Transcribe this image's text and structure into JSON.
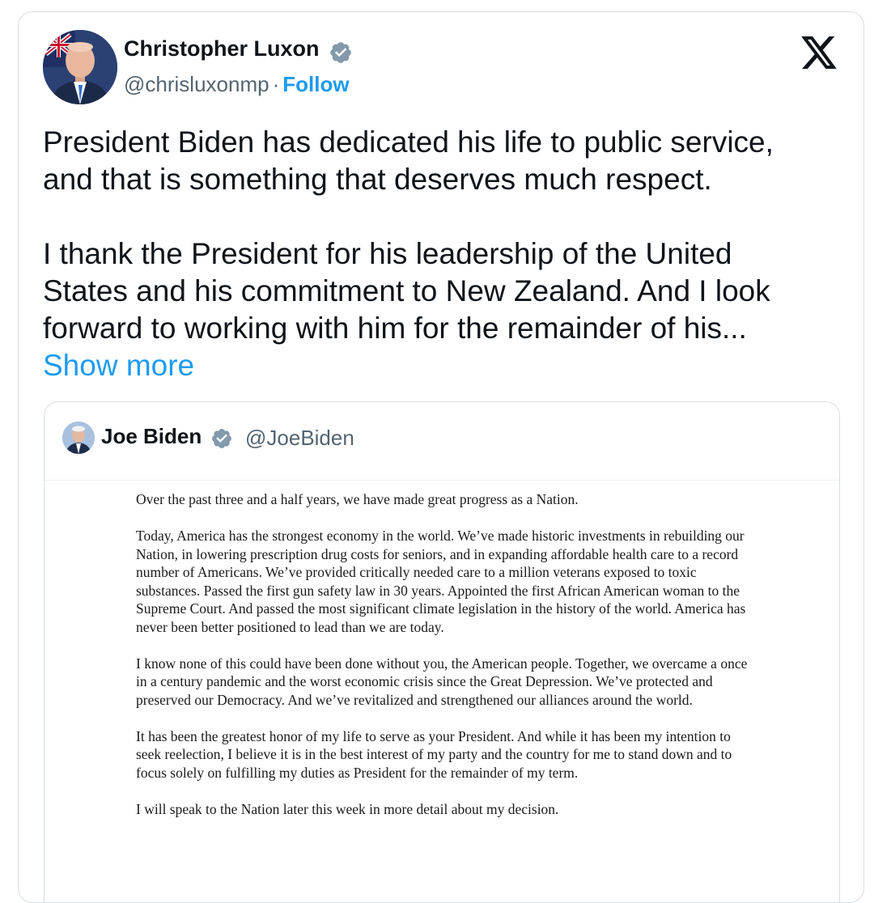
{
  "author": {
    "name": "Christopher Luxon",
    "handle": "@chrisluxonmp",
    "separator": "·",
    "follow_label": "Follow"
  },
  "icons": {
    "verified": "verified-badge-icon",
    "platform_logo": "x-logo-icon"
  },
  "tweet": {
    "paragraph_1": "President Biden has dedicated his life to public service, and that is something that deserves much respect.",
    "paragraph_2": "I thank the President for his leadership of the United States and his commitment to New Zealand. And I look forward to working with him for the remainder of his...",
    "show_more_label": "Show more"
  },
  "quoted_tweet": {
    "name": "Joe Biden",
    "handle": "@JoeBiden",
    "letter_paragraphs": [
      "Over the past three and a half years, we have made great progress as a Nation.",
      "Today, America has the strongest economy in the world. We’ve made historic investments in rebuilding our Nation, in lowering prescription drug costs for seniors, and in expanding affordable health care to a record number of Americans. We’ve provided critically needed care to a million veterans exposed to toxic substances. Passed the first gun safety law in 30 years. Appointed the first African American woman to the Supreme Court. And passed the most significant climate legislation in the history of the world. America has never been better positioned to lead than we are today.",
      "I know none of this could have been done without you, the American people. Together, we overcame a once in a century pandemic and the worst economic crisis since the Great Depression. We’ve protected and preserved our Democracy. And we’ve revitalized and strengthened our alliances around the world.",
      "It has been the greatest honor of my life to serve as your President. And while it has been my intention to seek reelection, I believe it is in the best interest of my party and the country for me to stand down and to focus solely on fulfilling my duties as President for the remainder of my term.",
      "I will speak to the Nation later this week in more detail about my decision."
    ]
  },
  "colors": {
    "accent": "#1d9bf0",
    "secondary_text": "#536471",
    "border": "#d9dee2",
    "verified_badge": "#829aab"
  }
}
